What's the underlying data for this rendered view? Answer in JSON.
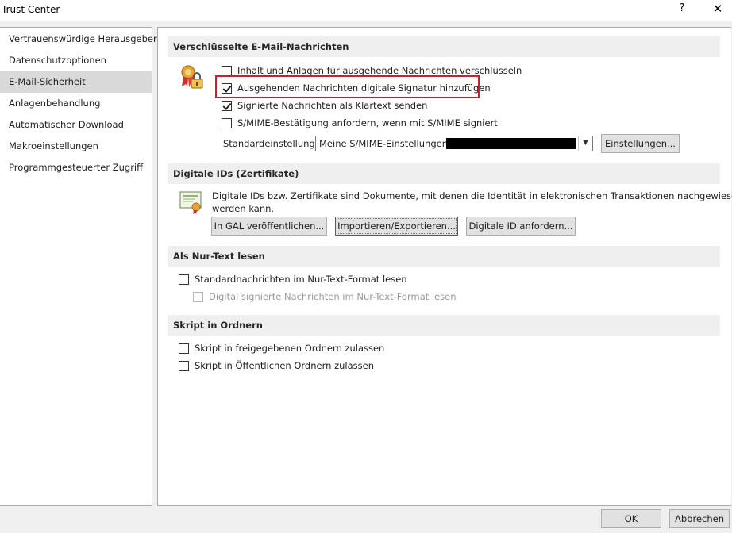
{
  "window": {
    "title": "Trust Center",
    "help_label": "?",
    "close_label": "✕"
  },
  "sidebar": {
    "items": [
      {
        "label": "Vertrauenswürdige Herausgeber"
      },
      {
        "label": "Datenschutzoptionen"
      },
      {
        "label": "E-Mail-Sicherheit",
        "selected": true
      },
      {
        "label": "Anlagenbehandlung"
      },
      {
        "label": "Automatischer Download"
      },
      {
        "label": "Makroeinstellungen"
      },
      {
        "label": "Programmgesteuerter Zugriff"
      }
    ]
  },
  "encrypted": {
    "header": "Verschlüsselte E-Mail-Nachrichten",
    "options": [
      {
        "label": "Inhalt und Anlagen für ausgehende Nachrichten verschlüsseln",
        "checked": false
      },
      {
        "label": "Ausgehenden Nachrichten digitale Signatur hinzufügen",
        "checked": true
      },
      {
        "label": "Signierte Nachrichten als Klartext senden",
        "checked": true
      },
      {
        "label": "S/MIME-Bestätigung anfordern, wenn mit S/MIME signiert",
        "checked": false
      }
    ],
    "default_label": "Standardeinstellung:",
    "default_value": "Meine S/MIME-Einstellungen",
    "settings_button": "Einstellungen..."
  },
  "digital_ids": {
    "header": "Digitale IDs (Zertifikate)",
    "description_line1": "Digitale IDs bzw. Zertifikate sind Dokumente, mit denen die Identität in elektronischen Transaktionen nachgewiesen",
    "description_line2": "werden kann.",
    "buttons": [
      {
        "label": "In GAL veröffentlichen..."
      },
      {
        "label": "Importieren/Exportieren..."
      },
      {
        "label": "Digitale ID anfordern..."
      }
    ]
  },
  "plain_text": {
    "header": "Als Nur-Text lesen",
    "options": [
      {
        "label": "Standardnachrichten im Nur-Text-Format lesen",
        "checked": false,
        "disabled": false
      },
      {
        "label": "Digital signierte Nachrichten im Nur-Text-Format lesen",
        "checked": false,
        "disabled": true
      }
    ]
  },
  "scripts": {
    "header": "Skript in Ordnern",
    "options": [
      {
        "label": "Skript in freigegebenen Ordnern zulassen",
        "checked": false
      },
      {
        "label": "Skript in Öffentlichen Ordnern zulassen",
        "checked": false
      }
    ]
  },
  "footer": {
    "ok_label": "OK",
    "cancel_label": "Abbrechen"
  },
  "colors": {
    "highlight": "#c0242c",
    "selected_nav": "#d9d9d9"
  }
}
